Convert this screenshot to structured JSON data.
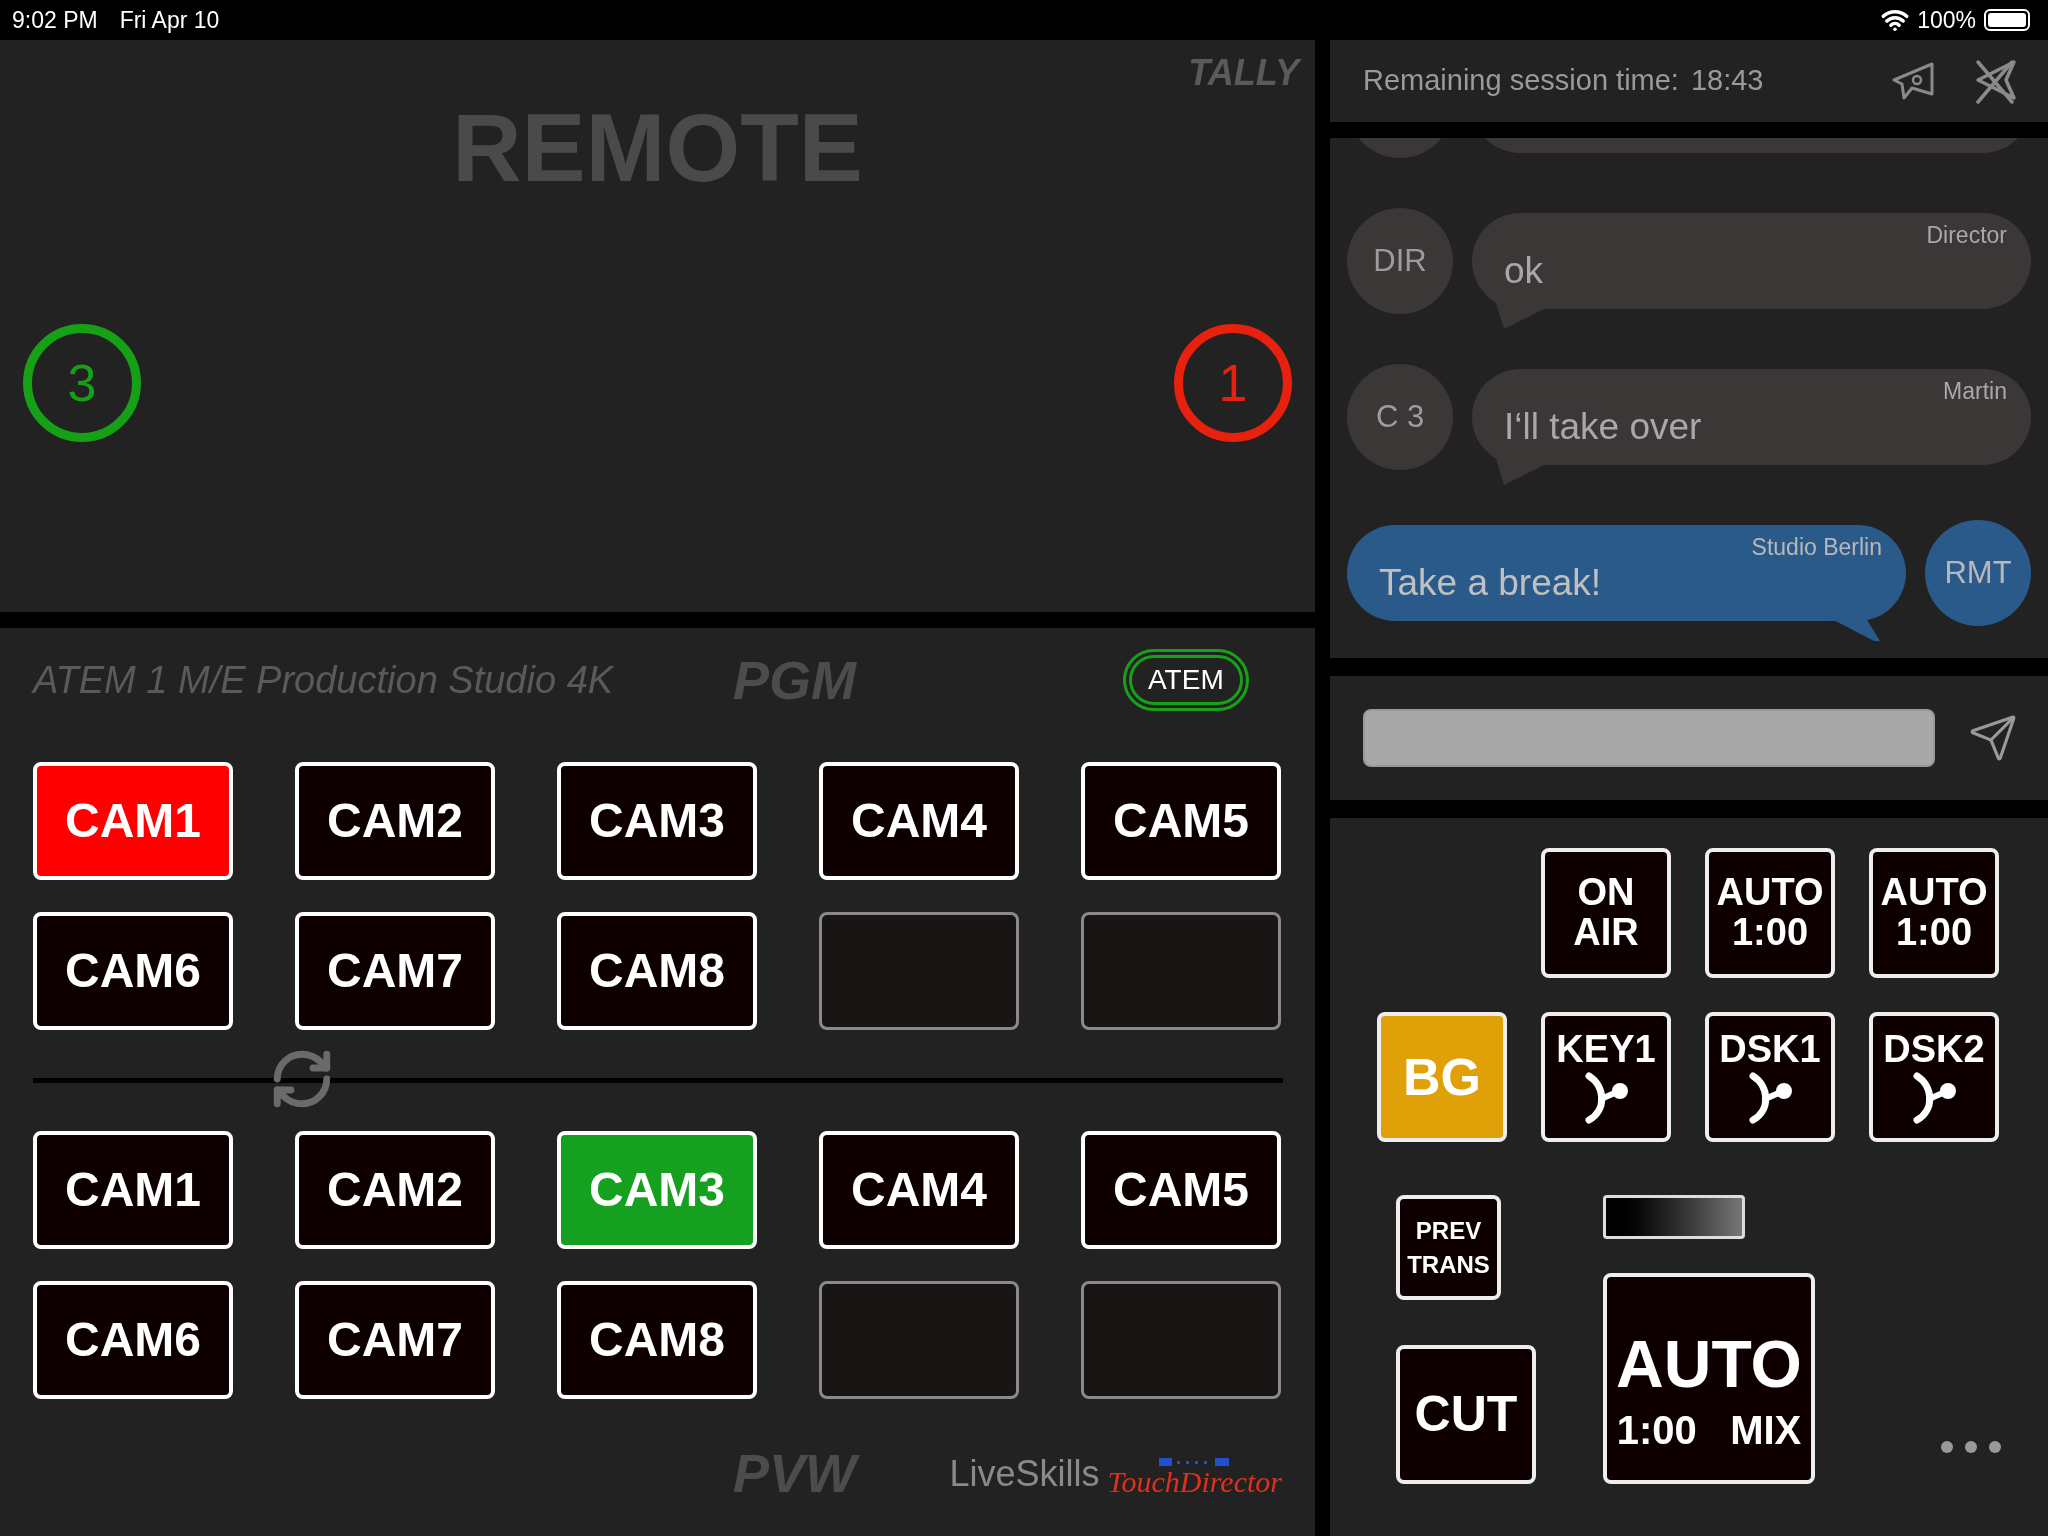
{
  "status_bar": {
    "time": "9:02 PM",
    "date": "Fri Apr 10",
    "battery": "100%"
  },
  "tally": {
    "label": "TALLY",
    "title": "REMOTE",
    "sources": [
      {
        "number": "3",
        "color": "#16a016"
      },
      {
        "number": "1",
        "color": "#e8200e"
      }
    ]
  },
  "switcher": {
    "model": "ATEM 1 M/E Production Studio 4K",
    "badge": "ATEM",
    "buses": [
      {
        "kind": "program",
        "title": "PGM",
        "buttons": [
          {
            "kind": "source",
            "label": "CAM1",
            "selected": true
          },
          {
            "kind": "source",
            "label": "CAM2",
            "selected": false
          },
          {
            "kind": "source",
            "label": "CAM3",
            "selected": false
          },
          {
            "kind": "source",
            "label": "CAM4",
            "selected": false
          },
          {
            "kind": "source",
            "label": "CAM5",
            "selected": false
          },
          {
            "kind": "source",
            "label": "CAM6",
            "selected": false
          },
          {
            "kind": "source",
            "label": "CAM7",
            "selected": false
          },
          {
            "kind": "source",
            "label": "CAM8",
            "selected": false
          },
          {
            "kind": "empty"
          },
          {
            "kind": "empty"
          }
        ]
      },
      {
        "kind": "preview",
        "title": "PVW",
        "buttons": [
          {
            "kind": "source",
            "label": "CAM1",
            "selected": false
          },
          {
            "kind": "source",
            "label": "CAM2",
            "selected": false
          },
          {
            "kind": "source",
            "label": "CAM3",
            "selected": true
          },
          {
            "kind": "source",
            "label": "CAM4",
            "selected": false
          },
          {
            "kind": "source",
            "label": "CAM5",
            "selected": false
          },
          {
            "kind": "source",
            "label": "CAM6",
            "selected": false
          },
          {
            "kind": "source",
            "label": "CAM7",
            "selected": false
          },
          {
            "kind": "source",
            "label": "CAM8",
            "selected": false
          },
          {
            "kind": "empty"
          },
          {
            "kind": "empty"
          }
        ]
      }
    ],
    "logo": {
      "brand": "LiveSkills",
      "product": "TouchDirector"
    }
  },
  "chat": {
    "session_label": "Remaining session time:",
    "session_time": "18:43",
    "messages": [
      {
        "kind": "incoming",
        "avatar": "DIR",
        "sender": "Director",
        "text": "ok"
      },
      {
        "kind": "incoming",
        "avatar": "C 3",
        "sender": "Martin",
        "text": "I‘ll take over"
      },
      {
        "kind": "outgoing",
        "avatar": "RMT",
        "sender": "Studio Berlin",
        "text": "Take a break!"
      }
    ]
  },
  "controls": {
    "buttons": [
      {
        "kind": "blank"
      },
      {
        "kind": "text",
        "lines": [
          "ON",
          "AIR"
        ],
        "on": false
      },
      {
        "kind": "text",
        "lines": [
          "AUTO",
          "1:00"
        ],
        "on": false
      },
      {
        "kind": "text",
        "lines": [
          "AUTO",
          "1:00"
        ],
        "on": false
      },
      {
        "kind": "text",
        "lines": [
          "BG"
        ],
        "on": true
      },
      {
        "kind": "key",
        "lines": [
          "KEY1"
        ],
        "on": false
      },
      {
        "kind": "key",
        "lines": [
          "DSK1"
        ],
        "on": false
      },
      {
        "kind": "key",
        "lines": [
          "DSK2"
        ],
        "on": false
      }
    ],
    "prev_trans": [
      "PREV",
      "TRANS"
    ],
    "cut": "CUT",
    "auto": {
      "label": "AUTO",
      "duration": "1:00",
      "mode": "MIX"
    }
  }
}
